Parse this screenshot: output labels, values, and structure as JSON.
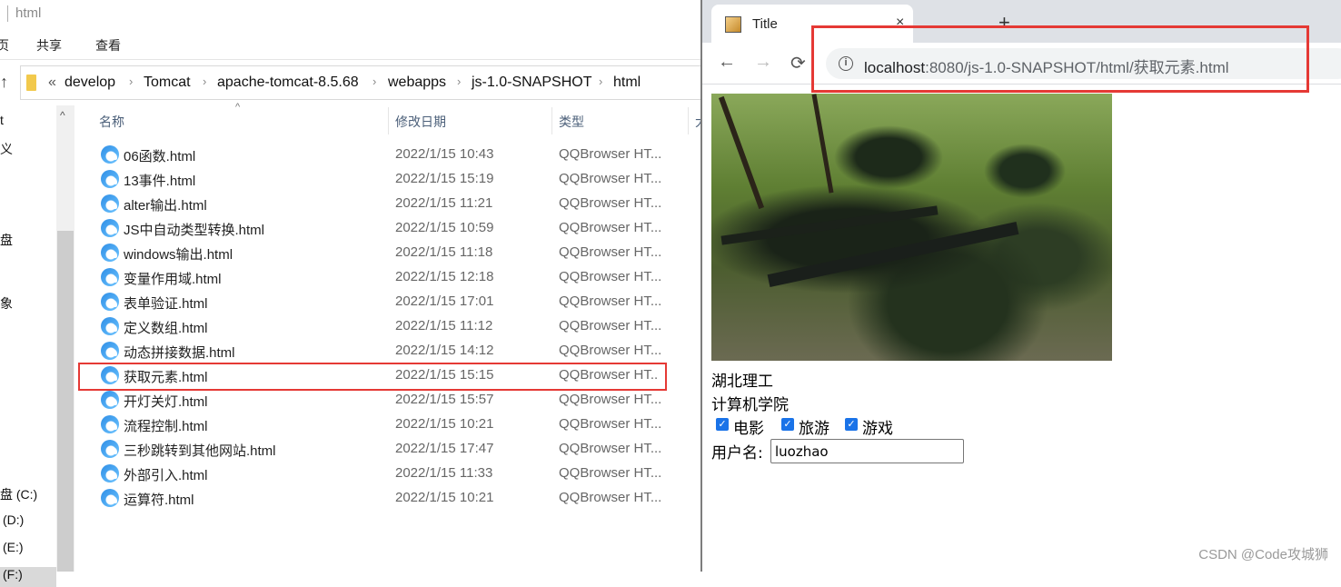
{
  "explorer": {
    "window_title": "html",
    "ribbon_tabs": [
      "页",
      "共享",
      "查看"
    ],
    "breadcrumb": [
      "develop",
      "Tomcat",
      "apache-tomcat-8.5.68",
      "webapps",
      "js-1.0-SNAPSHOT",
      "html"
    ],
    "breadcrumb_overflow": "«",
    "nav_pane": [
      "t",
      "义",
      "盘",
      "象",
      "盘 (C:)",
      "(D:)",
      "(E:)",
      "(F:)"
    ],
    "columns": [
      "名称",
      "修改日期",
      "类型",
      "大"
    ],
    "files": [
      {
        "name": "06函数.html",
        "date": "2022/1/15 10:43",
        "type": "QQBrowser HT..."
      },
      {
        "name": "13事件.html",
        "date": "2022/1/15 15:19",
        "type": "QQBrowser HT..."
      },
      {
        "name": "alter输出.html",
        "date": "2022/1/15 11:21",
        "type": "QQBrowser HT..."
      },
      {
        "name": "JS中自动类型转换.html",
        "date": "2022/1/15 10:59",
        "type": "QQBrowser HT..."
      },
      {
        "name": "windows输出.html",
        "date": "2022/1/15 11:18",
        "type": "QQBrowser HT..."
      },
      {
        "name": "变量作用域.html",
        "date": "2022/1/15 12:18",
        "type": "QQBrowser HT..."
      },
      {
        "name": "表单验证.html",
        "date": "2022/1/15 17:01",
        "type": "QQBrowser HT..."
      },
      {
        "name": "定义数组.html",
        "date": "2022/1/15 11:12",
        "type": "QQBrowser HT..."
      },
      {
        "name": "动态拼接数据.html",
        "date": "2022/1/15 14:12",
        "type": "QQBrowser HT..."
      },
      {
        "name": "获取元素.html",
        "date": "2022/1/15 15:15",
        "type": "QQBrowser HT..",
        "highlighted": true
      },
      {
        "name": "开灯关灯.html",
        "date": "2022/1/15 15:57",
        "type": "QQBrowser HT..."
      },
      {
        "name": "流程控制.html",
        "date": "2022/1/15 10:21",
        "type": "QQBrowser HT..."
      },
      {
        "name": "三秒跳转到其他网站.html",
        "date": "2022/1/15 17:47",
        "type": "QQBrowser HT..."
      },
      {
        "name": "外部引入.html",
        "date": "2022/1/15 11:33",
        "type": "QQBrowser HT..."
      },
      {
        "name": "运算符.html",
        "date": "2022/1/15 10:21",
        "type": "QQBrowser HT..."
      }
    ]
  },
  "browser": {
    "tab_title": "Title",
    "tab_close": "×",
    "new_tab": "+",
    "url_host": "localhost",
    "url_path": ":8080/js-1.0-SNAPSHOT/html/获取元素.html",
    "back": "←",
    "forward": "→",
    "reload": "⟳",
    "info_icon": "i"
  },
  "page": {
    "line1": "湖北理工",
    "line2": "计算机学院",
    "checkboxes": [
      {
        "label": "电影",
        "checked": true
      },
      {
        "label": "旅游",
        "checked": true
      },
      {
        "label": "游戏",
        "checked": true
      }
    ],
    "username_label": "用户名:",
    "username_value": "luozhao",
    "image_alt": "soldiers in forest photo"
  },
  "watermark": "CSDN @Code攻城狮",
  "colors": {
    "highlight": "#e53935",
    "checkbox": "#1a73e8"
  }
}
